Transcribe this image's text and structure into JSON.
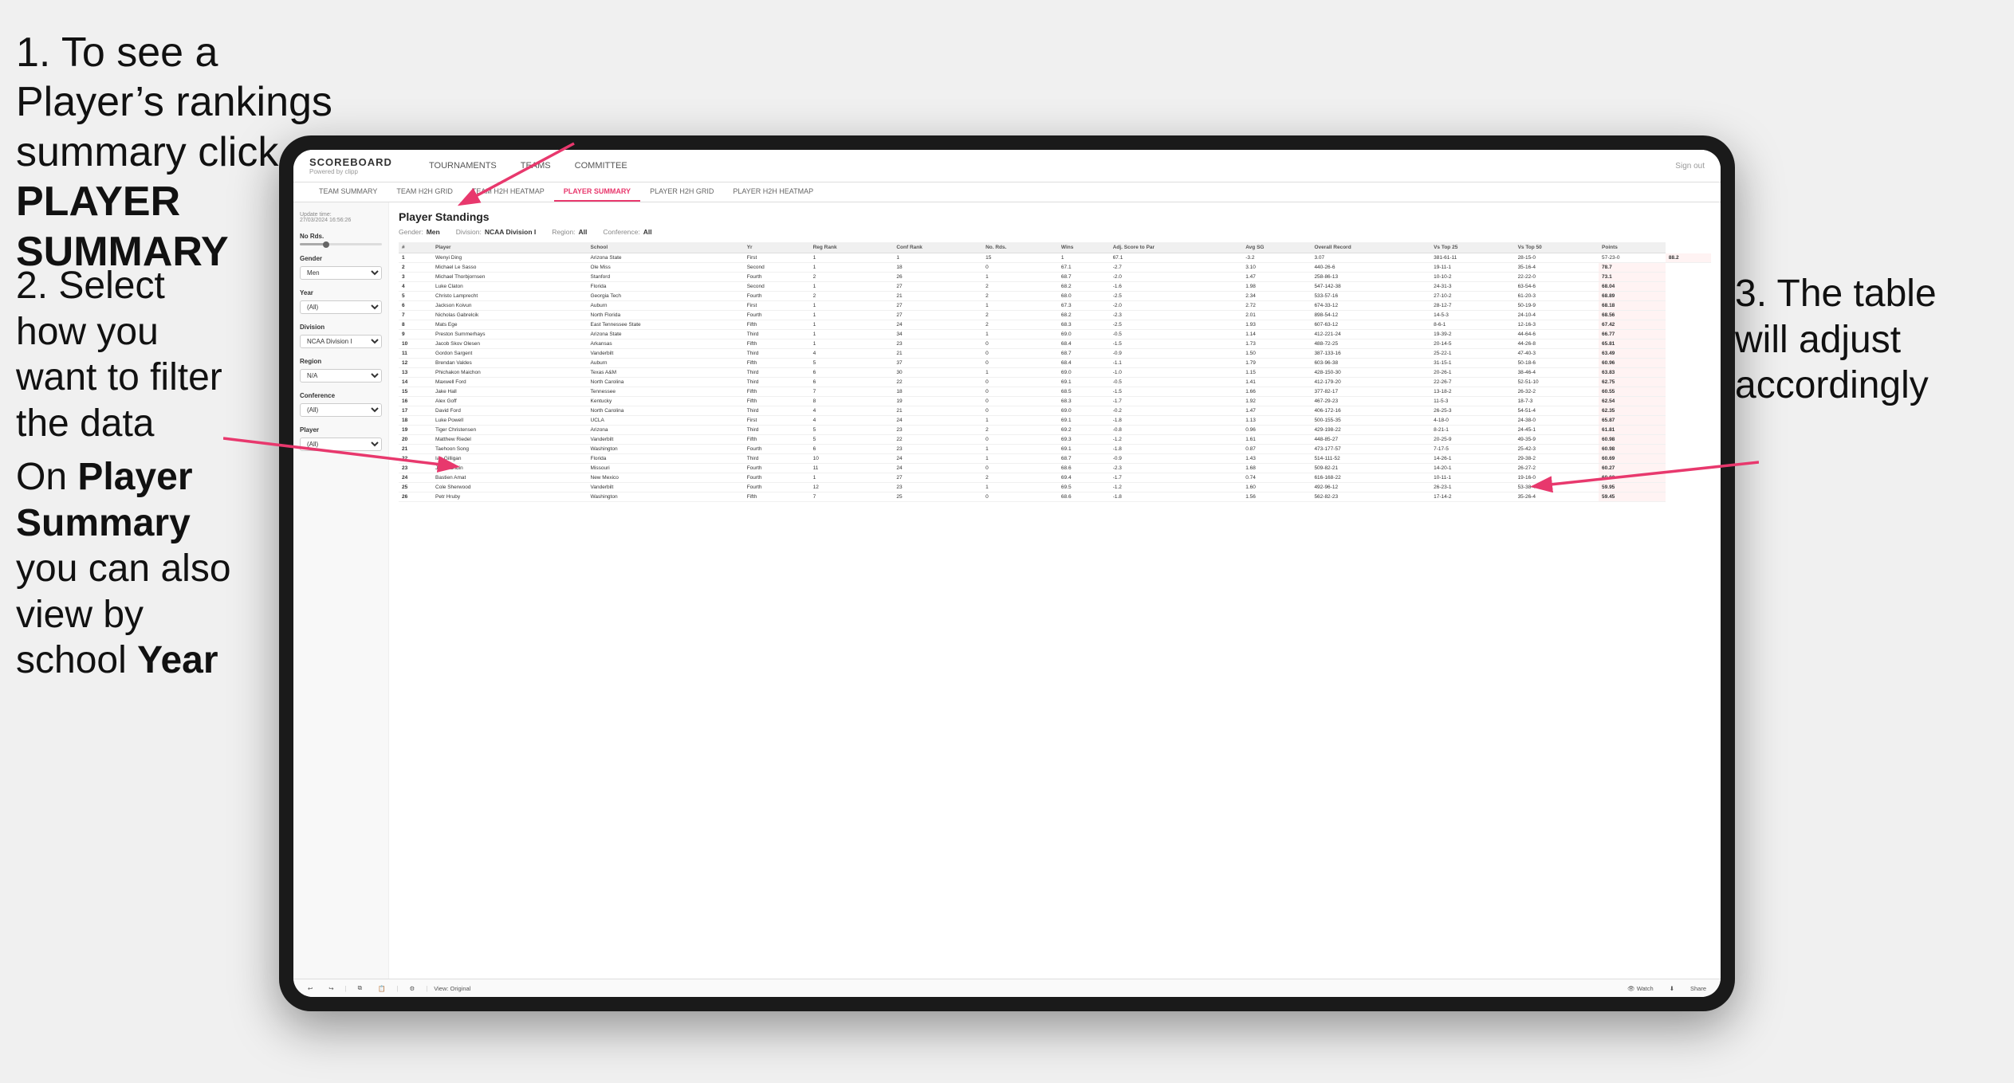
{
  "instructions": {
    "step1": "1. To see a Player’s rankings summary click ",
    "step1_bold": "PLAYER SUMMARY",
    "step2_line1": "2. Select how you want to filter the data",
    "step3": "3. The table will adjust accordingly",
    "bottom_note_pre": "On ",
    "bottom_bold": "Player Summary",
    "bottom_note_post": " you can also view by school ",
    "bottom_year": "Year"
  },
  "nav": {
    "logo": "SCOREBOARD",
    "logo_sub": "Powered by clipp",
    "items": [
      "TOURNAMENTS",
      "TEAMS",
      "COMMITTEE"
    ],
    "sign_in": "Sign out"
  },
  "sub_nav": {
    "items": [
      "TEAM SUMMARY",
      "TEAM H2H GRID",
      "TEAM H2H HEATMAP",
      "PLAYER SUMMARY",
      "PLAYER H2H GRID",
      "PLAYER H2H HEATMAP"
    ]
  },
  "sidebar": {
    "update_label": "Update time:",
    "update_time": "27/03/2024 16:56:26",
    "no_rds_label": "No Rds.",
    "gender_label": "Gender",
    "gender_value": "Men",
    "year_label": "Year",
    "year_value": "(All)",
    "division_label": "Division",
    "division_value": "NCAA Division I",
    "region_label": "Region",
    "region_value": "N/A",
    "conference_label": "Conference",
    "conference_value": "(All)",
    "player_label": "Player",
    "player_value": "(All)"
  },
  "table": {
    "title": "Player Standings",
    "filters": {
      "gender_label": "Gender:",
      "gender_value": "Men",
      "division_label": "Division:",
      "division_value": "NCAA Division I",
      "region_label": "Region:",
      "region_value": "All",
      "conference_label": "Conference:",
      "conference_value": "All"
    },
    "columns": [
      "#",
      "Player",
      "School",
      "Yr",
      "Reg Rank",
      "Conf Rank",
      "No. Rds.",
      "Wins",
      "Adj. Score to Par",
      "Avg SG",
      "Overall Record",
      "Vs Top 25",
      "Vs Top 50",
      "Points"
    ],
    "rows": [
      [
        "1",
        "Wenyi Ding",
        "Arizona State",
        "First",
        "1",
        "1",
        "15",
        "1",
        "67.1",
        "-3.2",
        "3.07",
        "381-61-11",
        "28-15-0",
        "57-23-0",
        "88.2"
      ],
      [
        "2",
        "Michael Le Sasso",
        "Ole Miss",
        "Second",
        "1",
        "18",
        "0",
        "67.1",
        "-2.7",
        "3.10",
        "440-26-6",
        "19-11-1",
        "35-16-4",
        "78.7"
      ],
      [
        "3",
        "Michael Thorbjornsen",
        "Stanford",
        "Fourth",
        "2",
        "26",
        "1",
        "68.7",
        "-2.0",
        "1.47",
        "258-86-13",
        "10-10-2",
        "22-22-0",
        "73.1"
      ],
      [
        "4",
        "Luke Claton",
        "Florida",
        "Second",
        "1",
        "27",
        "2",
        "68.2",
        "-1.6",
        "1.98",
        "547-142-38",
        "24-31-3",
        "63-54-6",
        "68.04"
      ],
      [
        "5",
        "Christo Lamprecht",
        "Georgia Tech",
        "Fourth",
        "2",
        "21",
        "2",
        "68.0",
        "-2.5",
        "2.34",
        "533-57-16",
        "27-10-2",
        "61-20-3",
        "68.89"
      ],
      [
        "6",
        "Jackson Koivun",
        "Auburn",
        "First",
        "1",
        "27",
        "1",
        "67.3",
        "-2.0",
        "2.72",
        "674-33-12",
        "28-12-7",
        "50-19-9",
        "68.18"
      ],
      [
        "7",
        "Nicholas Gabrelcik",
        "North Florida",
        "Fourth",
        "1",
        "27",
        "2",
        "68.2",
        "-2.3",
        "2.01",
        "898-54-12",
        "14-5-3",
        "24-10-4",
        "68.56"
      ],
      [
        "8",
        "Mats Ege",
        "East Tennessee State",
        "Fifth",
        "1",
        "24",
        "2",
        "68.3",
        "-2.5",
        "1.93",
        "607-63-12",
        "8-6-1",
        "12-16-3",
        "67.42"
      ],
      [
        "9",
        "Preston Summerhays",
        "Arizona State",
        "Third",
        "1",
        "34",
        "1",
        "69.0",
        "-0.5",
        "1.14",
        "412-221-24",
        "19-39-2",
        "44-64-6",
        "66.77"
      ],
      [
        "10",
        "Jacob Skov Olesen",
        "Arkansas",
        "Fifth",
        "1",
        "23",
        "0",
        "68.4",
        "-1.5",
        "1.73",
        "488-72-25",
        "20-14-5",
        "44-26-8",
        "65.81"
      ],
      [
        "11",
        "Gordon Sargent",
        "Vanderbilt",
        "Third",
        "4",
        "21",
        "0",
        "68.7",
        "-0.9",
        "1.50",
        "387-133-16",
        "25-22-1",
        "47-40-3",
        "63.49"
      ],
      [
        "12",
        "Brendan Valdes",
        "Auburn",
        "Fifth",
        "5",
        "37",
        "0",
        "68.4",
        "-1.1",
        "1.79",
        "603-96-38",
        "31-15-1",
        "50-18-6",
        "60.96"
      ],
      [
        "13",
        "Phichakon Maichon",
        "Texas A&M",
        "Third",
        "6",
        "30",
        "1",
        "69.0",
        "-1.0",
        "1.15",
        "428-150-30",
        "20-26-1",
        "38-46-4",
        "63.83"
      ],
      [
        "14",
        "Maxwell Ford",
        "North Carolina",
        "Third",
        "6",
        "22",
        "0",
        "69.1",
        "-0.5",
        "1.41",
        "412-179-20",
        "22-26-7",
        "52-51-10",
        "62.75"
      ],
      [
        "15",
        "Jake Hall",
        "Tennessee",
        "Fifth",
        "7",
        "18",
        "0",
        "68.5",
        "-1.5",
        "1.66",
        "377-82-17",
        "13-18-2",
        "26-32-2",
        "60.55"
      ],
      [
        "16",
        "Alex Goff",
        "Kentucky",
        "Fifth",
        "8",
        "19",
        "0",
        "68.3",
        "-1.7",
        "1.92",
        "467-29-23",
        "11-5-3",
        "18-7-3",
        "62.54"
      ],
      [
        "17",
        "David Ford",
        "North Carolina",
        "Third",
        "4",
        "21",
        "0",
        "69.0",
        "-0.2",
        "1.47",
        "406-172-16",
        "26-25-3",
        "54-51-4",
        "62.35"
      ],
      [
        "18",
        "Luke Powell",
        "UCLA",
        "First",
        "4",
        "24",
        "1",
        "69.1",
        "-1.8",
        "1.13",
        "500-155-35",
        "4-18-0",
        "24-38-0",
        "65.87"
      ],
      [
        "19",
        "Tiger Christensen",
        "Arizona",
        "Third",
        "5",
        "23",
        "2",
        "69.2",
        "-0.8",
        "0.96",
        "429-198-22",
        "8-21-1",
        "24-45-1",
        "61.81"
      ],
      [
        "20",
        "Matthew Riedel",
        "Vanderbilt",
        "Fifth",
        "5",
        "22",
        "0",
        "69.3",
        "-1.2",
        "1.61",
        "448-85-27",
        "20-25-9",
        "49-35-9",
        "60.98"
      ],
      [
        "21",
        "Taehoon Song",
        "Washington",
        "Fourth",
        "6",
        "23",
        "1",
        "69.1",
        "-1.8",
        "0.87",
        "473-177-57",
        "7-17-5",
        "25-42-3",
        "60.98"
      ],
      [
        "22",
        "Ian Gilligan",
        "Florida",
        "Third",
        "10",
        "24",
        "1",
        "68.7",
        "-0.9",
        "1.43",
        "514-111-52",
        "14-26-1",
        "29-38-2",
        "60.69"
      ],
      [
        "23",
        "Jack Lundin",
        "Missouri",
        "Fourth",
        "11",
        "24",
        "0",
        "68.6",
        "-2.3",
        "1.68",
        "509-82-21",
        "14-20-1",
        "26-27-2",
        "60.27"
      ],
      [
        "24",
        "Bastien Amat",
        "New Mexico",
        "Fourth",
        "1",
        "27",
        "2",
        "69.4",
        "-1.7",
        "0.74",
        "616-168-22",
        "10-11-1",
        "19-16-0",
        "60.02"
      ],
      [
        "25",
        "Cole Sherwood",
        "Vanderbilt",
        "Fourth",
        "12",
        "23",
        "1",
        "69.5",
        "-1.2",
        "1.60",
        "492-96-12",
        "26-23-1",
        "53-38-4",
        "59.95"
      ],
      [
        "26",
        "Petr Hruby",
        "Washington",
        "Fifth",
        "7",
        "25",
        "0",
        "68.6",
        "-1.8",
        "1.56",
        "562-82-23",
        "17-14-2",
        "35-26-4",
        "59.45"
      ]
    ]
  },
  "toolbar": {
    "view_label": "View: Original",
    "watch_label": "Watch",
    "share_label": "Share"
  }
}
